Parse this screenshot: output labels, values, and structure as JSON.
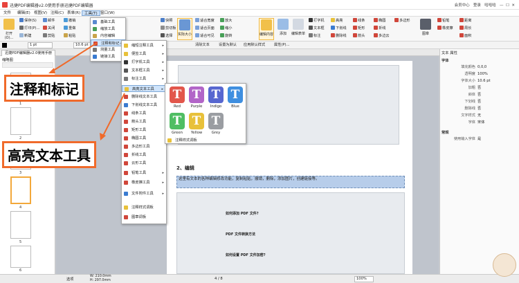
{
  "title": "迅捷PDF编辑器v2.0使用手册迅捷PDF编辑器",
  "titlebar_right": {
    "member": "会员中心",
    "login": "登录",
    "account": "哈哈哈"
  },
  "menubar": [
    "文件",
    "编辑(E)",
    "视图(V)",
    "注释(C)",
    "表单(R)",
    "工具(T)",
    "窗口(W)"
  ],
  "ribbon": {
    "open": "打开(O)...",
    "r1": [
      "保存(S)",
      "邮件",
      "撤销",
      "快照",
      "全部选择"
    ],
    "r2": [
      "打印(P)...",
      "关闭",
      "重做",
      "剪切板",
      "查找"
    ],
    "r3": [
      "新建",
      "剪贴",
      "粘贴",
      "选择",
      "清除全选"
    ],
    "zoom_btn": "实际大小",
    "fit": [
      "适合宽度",
      "适合页面",
      "适合可见"
    ],
    "zoom": [
      "放大",
      "缩小",
      "旋转"
    ],
    "view_btn": "编辑内容",
    "add_label": "添加",
    "edit_form": "编辑表单",
    "text": [
      "打字机",
      "文本框",
      "标注"
    ],
    "highlight": [
      "高亮",
      "下划线",
      "删除线"
    ],
    "strike": [
      "线条",
      "矩形",
      "箭头",
      "椭圆"
    ],
    "poly": [
      "多边形",
      "折线",
      "多边云"
    ],
    "stamp": "图章",
    "right_tools": [
      "铅笔",
      "橡皮擦",
      "距离",
      "周长",
      "面积"
    ]
  },
  "fmt": {
    "line": "1 pt",
    "font_size": "10.6 pt",
    "btns": [
      "清除文本",
      "设置为默认",
      "应用默认样式",
      "属性(P)..."
    ]
  },
  "tab": "迅捷PDF编辑器v2.0使用手册",
  "thumbpanel": {
    "title": "缩略图",
    "pages": [
      "1",
      "2",
      "3",
      "4",
      "5",
      "6"
    ]
  },
  "tools_menu": [
    "基础工具",
    "缩放工具",
    "内容编辑",
    "注释和标记",
    "测量工具",
    "链接工具"
  ],
  "submenu": [
    "缩短注释工具",
    "便签工具",
    "打字机工具",
    "文本框工具",
    "标注工具",
    "高亮文本工具",
    "删除线文本工具",
    "下划线文本工具",
    "线条工具",
    "箭头工具",
    "矩形工具",
    "椭圆工具",
    "多边形工具",
    "折线工具",
    "云形工具",
    "铅笔工具",
    "橡皮擦工具",
    "文件附件工具",
    "注释样式调板",
    "图章调板"
  ],
  "colors": [
    {
      "name": "Red",
      "color": "#e2564b"
    },
    {
      "name": "Purple",
      "color": "#b265c8"
    },
    {
      "name": "Indigo",
      "color": "#5767d0"
    },
    {
      "name": "Blue",
      "color": "#3f8fe0"
    },
    {
      "name": "Green",
      "color": "#4fbe63"
    },
    {
      "name": "Yellow",
      "color": "#e8c13a"
    },
    {
      "name": "Grey",
      "color": "#9a9da2"
    }
  ],
  "palette_link": "注释样式调板",
  "callouts": {
    "c1": "注释和标记",
    "c2": "高亮文本工具"
  },
  "doc": {
    "heading": "2、编辑",
    "highlighted": "这里有文本的各种编辑修改功能，复制粘贴，撤销，删除，添加图片，创建链接等。",
    "q1": "如何添加 PDF 文件?",
    "q2": "PDF 文件转换方法",
    "q3": "如何设置 PDF 文件加密?"
  },
  "rightpanel": {
    "header": "文本 属性",
    "section1": "字体",
    "props": [
      {
        "k": "填充颜色",
        "v": "0,0,0"
      },
      {
        "k": "透明度",
        "v": "100%"
      },
      {
        "k": "字体大小",
        "v": "10.6 pt"
      },
      {
        "k": "加粗",
        "v": "否"
      },
      {
        "k": "斜体",
        "v": "否"
      },
      {
        "k": "下划线",
        "v": "否"
      },
      {
        "k": "删除线",
        "v": "否"
      },
      {
        "k": "文字样式",
        "v": "无"
      },
      {
        "k": "字体",
        "v": "宋体"
      }
    ],
    "section2": "常规",
    "props2": [
      {
        "k": "使用输入字体",
        "v": "是"
      }
    ]
  },
  "status": {
    "tool": "选项",
    "w": "W: 210.0mm",
    "h": "H: 297.0mm",
    "page": "4 / 8",
    "zoom": "100%"
  }
}
